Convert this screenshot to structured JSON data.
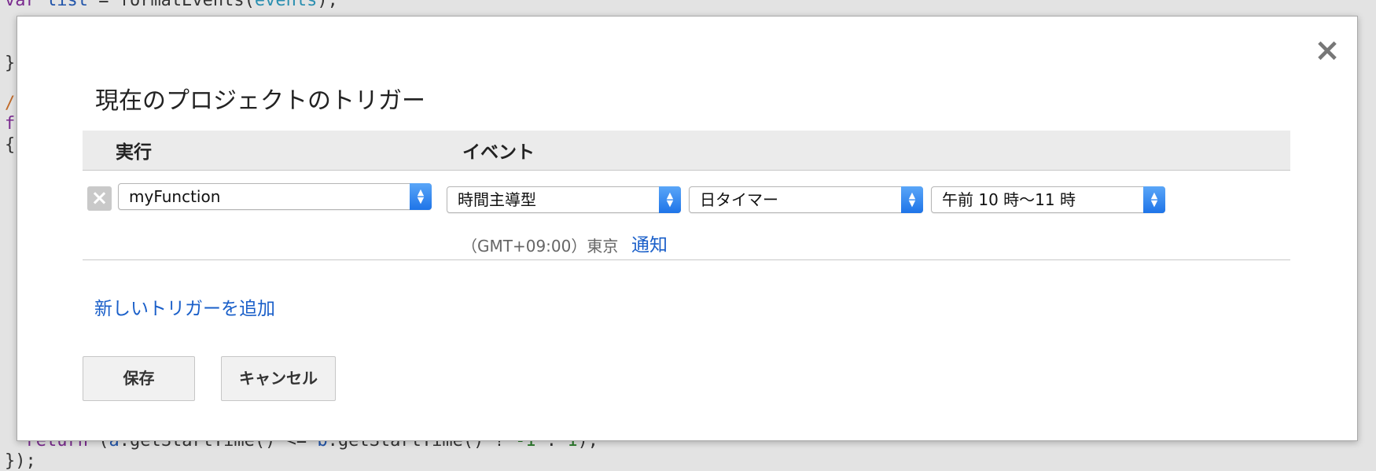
{
  "background_code": {
    "line1_a": "var ",
    "line1_b": "list",
    "line1_c": " = formatEvents(",
    "line1_d": "events",
    "line1_e": ");",
    "line2": "}",
    "line3": "/",
    "line4": "f",
    "line5": "{",
    "line6_a": "  return",
    "line6_b": " (",
    "line6_c": "a",
    "line6_d": ".getStartTime() <= ",
    "line6_e": "b",
    "line6_f": ".getStartTime() ? ",
    "line6_g": "-1",
    "line6_h": " : ",
    "line6_i": "1",
    "line6_j": ");",
    "line7": "});"
  },
  "dialog": {
    "close_label": "×",
    "title": "現在のプロジェクトのトリガー",
    "headers": {
      "run": "実行",
      "event": "イベント"
    },
    "trigger": {
      "delete_label": "×",
      "function": "myFunction",
      "event_source": "時間主導型",
      "timer_type": "日タイマー",
      "time_of_day": "午前 10 時〜11 時",
      "timezone": "（GMT+09:00）東京",
      "notify_label": "通知"
    },
    "add_trigger_label": "新しいトリガーを追加",
    "save_label": "保存",
    "cancel_label": "キャンセル"
  },
  "colors": {
    "link": "#1a5fc9",
    "select_arrow": "#1e74e8"
  }
}
